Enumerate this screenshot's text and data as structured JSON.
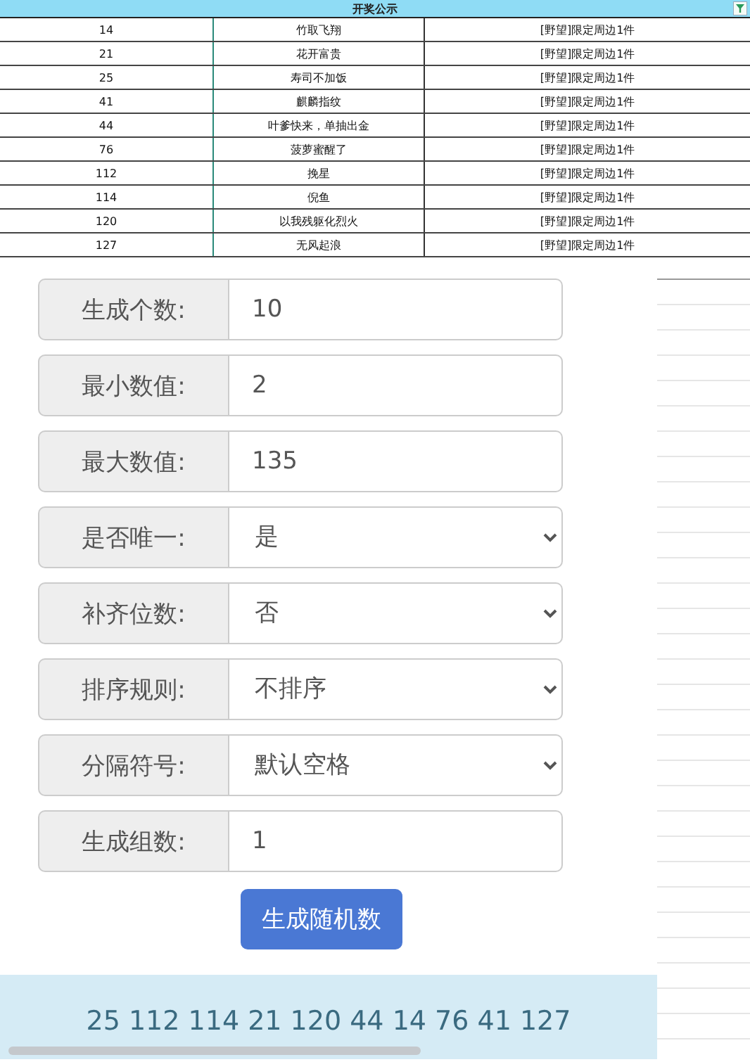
{
  "table": {
    "title": "开奖公示",
    "rows": [
      {
        "number": "14",
        "name": "竹取飞翔",
        "prize": "[野望]限定周边1件"
      },
      {
        "number": "21",
        "name": "花开富贵",
        "prize": "[野望]限定周边1件"
      },
      {
        "number": "25",
        "name": "寿司不加饭",
        "prize": "[野望]限定周边1件"
      },
      {
        "number": "41",
        "name": "麒麟指纹",
        "prize": "[野望]限定周边1件"
      },
      {
        "number": "44",
        "name": "叶爹快来，单抽出金",
        "prize": "[野望]限定周边1件"
      },
      {
        "number": "76",
        "name": "菠萝蜜醒了",
        "prize": "[野望]限定周边1件"
      },
      {
        "number": "112",
        "name": "挽星",
        "prize": "[野望]限定周边1件"
      },
      {
        "number": "114",
        "name": "倪鱼",
        "prize": "[野望]限定周边1件"
      },
      {
        "number": "120",
        "name": "以我残躯化烈火",
        "prize": "[野望]限定周边1件"
      },
      {
        "number": "127",
        "name": "无风起浪",
        "prize": "[野望]限定周边1件"
      }
    ]
  },
  "form": {
    "fields": [
      {
        "kind": "input",
        "label": "生成个数:",
        "value": "10"
      },
      {
        "kind": "input",
        "label": "最小数值:",
        "value": "2"
      },
      {
        "kind": "input",
        "label": "最大数值:",
        "value": "135"
      },
      {
        "kind": "select",
        "label": "是否唯一:",
        "value": "是"
      },
      {
        "kind": "select",
        "label": "补齐位数:",
        "value": "否"
      },
      {
        "kind": "select",
        "label": "排序规则:",
        "value": "不排序"
      },
      {
        "kind": "select",
        "label": "分隔符号:",
        "value": "默认空格"
      },
      {
        "kind": "input",
        "label": "生成组数:",
        "value": "1"
      }
    ],
    "button": "生成随机数"
  },
  "result": "25 112 114 21 120 44 14 76 41 127"
}
